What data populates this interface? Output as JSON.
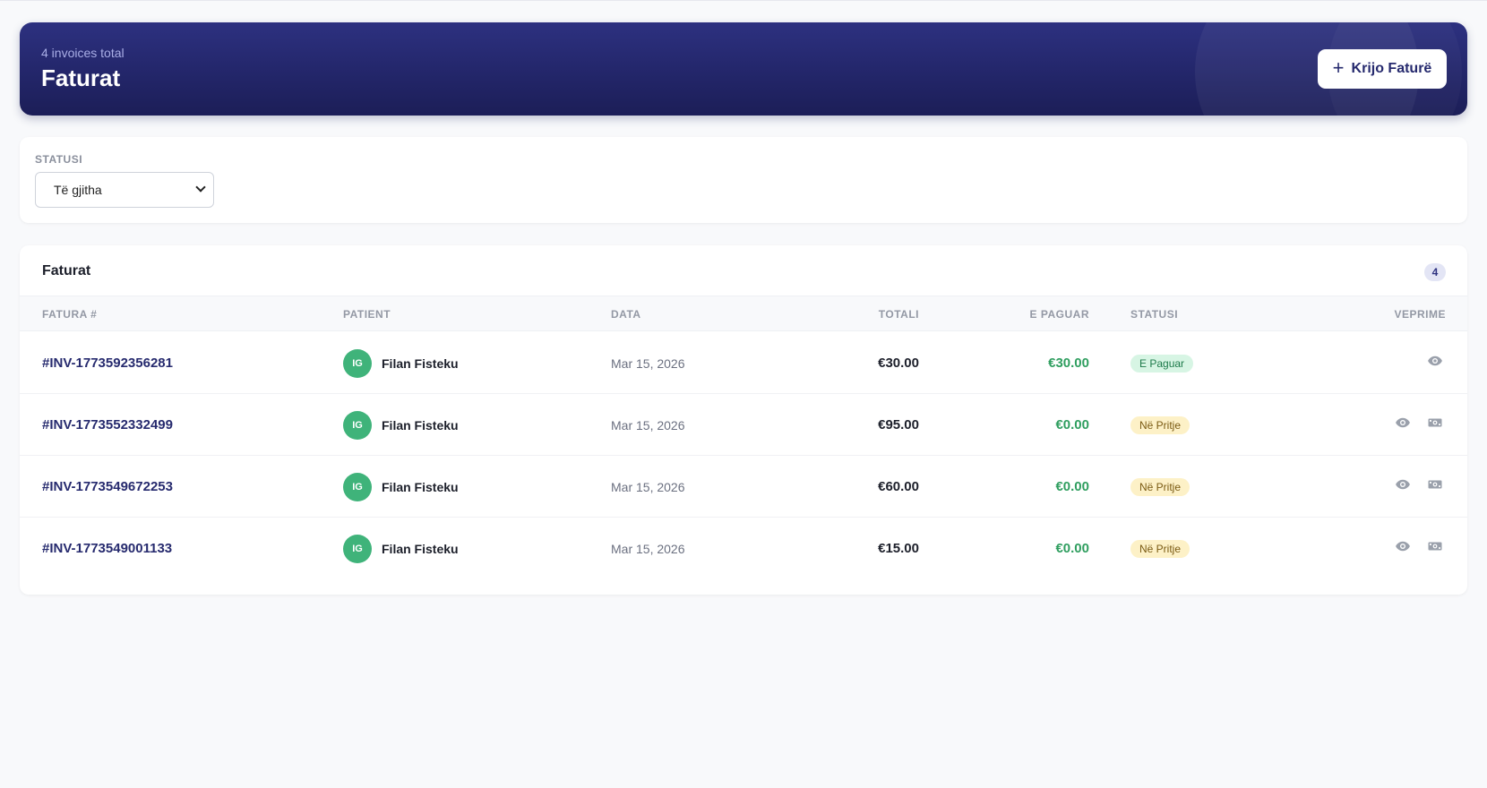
{
  "header": {
    "subtitle": "4 invoices total",
    "title": "Faturat",
    "create_button_label": "Krijo Faturë",
    "create_button_icon": "plus-icon"
  },
  "filter": {
    "label": "STATUSI",
    "selected": "Të gjitha"
  },
  "table": {
    "title": "Faturat",
    "count": "4",
    "columns": {
      "invoice": "FATURA #",
      "patient": "PATIENT",
      "date": "DATA",
      "total": "TOTALI",
      "paid": "E PAGUAR",
      "status": "STATUSI",
      "actions": "VEPRIME"
    },
    "rows": [
      {
        "invoice": "#INV-1773592356281",
        "initials": "IG",
        "patient": "Filan Fisteku",
        "date": "Mar 15, 2026",
        "total": "€30.00",
        "paid": "€30.00",
        "status": "E Paguar",
        "status_type": "paid"
      },
      {
        "invoice": "#INV-1773552332499",
        "initials": "IG",
        "patient": "Filan Fisteku",
        "date": "Mar 15, 2026",
        "total": "€95.00",
        "paid": "€0.00",
        "status": "Në Pritje",
        "status_type": "pending"
      },
      {
        "invoice": "#INV-1773549672253",
        "initials": "IG",
        "patient": "Filan Fisteku",
        "date": "Mar 15, 2026",
        "total": "€60.00",
        "paid": "€0.00",
        "status": "Në Pritje",
        "status_type": "pending"
      },
      {
        "invoice": "#INV-1773549001133",
        "initials": "IG",
        "patient": "Filan Fisteku",
        "date": "Mar 15, 2026",
        "total": "€15.00",
        "paid": "€0.00",
        "status": "Në Pritje",
        "status_type": "pending"
      }
    ]
  },
  "icons": {
    "view": "eye-icon",
    "pay": "money-icon"
  },
  "colors": {
    "primary": "#262a6e",
    "banner_gradient_start": "#2d3180",
    "banner_gradient_end": "#1c1e57",
    "paid_green": "#2f9e5f",
    "avatar_green": "#3fb37a",
    "pending_badge_bg": "#fdf1c7",
    "paid_badge_bg": "#d7f5e4"
  }
}
